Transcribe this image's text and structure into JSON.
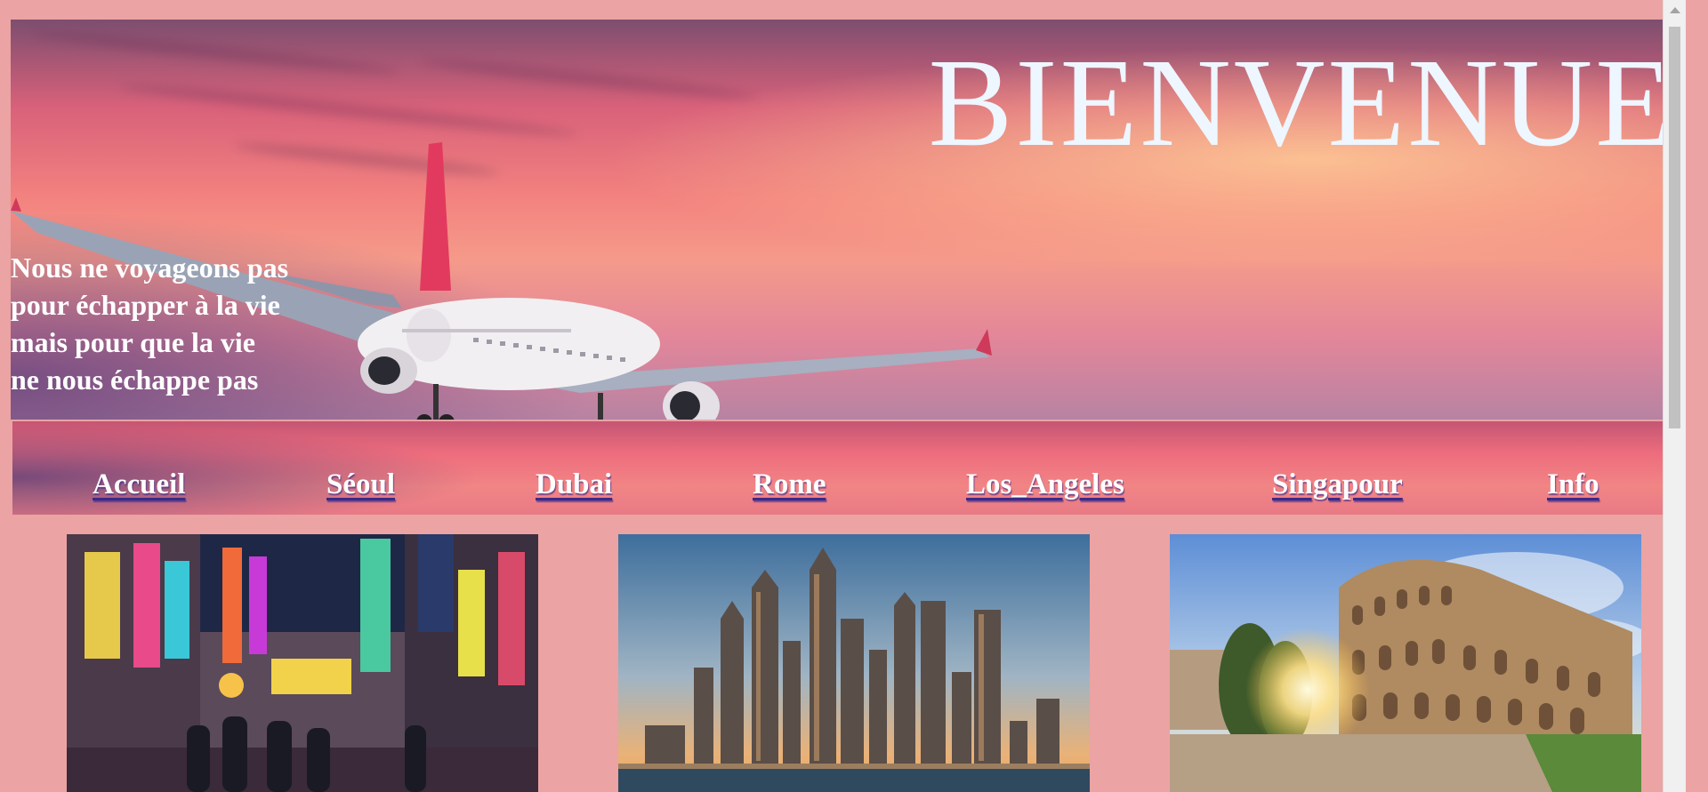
{
  "hero": {
    "title": "BIENVENUE",
    "quote_lines": [
      "Nous ne voyageons pas",
      "pour échapper à la vie",
      "mais pour que la vie",
      "ne nous échappe pas"
    ]
  },
  "nav": {
    "items": [
      {
        "label": "Accueil"
      },
      {
        "label": "Séoul"
      },
      {
        "label": "Dubai"
      },
      {
        "label": "Rome"
      },
      {
        "label": "Los_Angeles"
      },
      {
        "label": "Singapour"
      },
      {
        "label": "Info"
      }
    ]
  },
  "cards": [
    {
      "image": "seoul-street-night-image"
    },
    {
      "image": "dubai-skyline-image"
    },
    {
      "image": "rome-colosseum-image"
    }
  ],
  "colors": {
    "page_background": "#eba3a3",
    "title_color": "#eef6ff",
    "nav_text": "#ffffff",
    "nav_underline": "#3a2a88"
  }
}
